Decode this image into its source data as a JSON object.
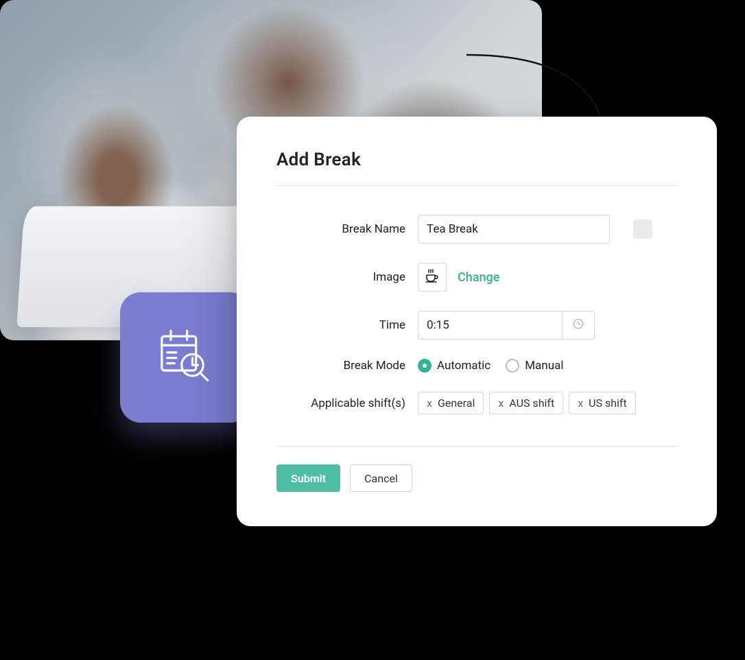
{
  "dialog": {
    "title": "Add Break",
    "fields": {
      "break_name": {
        "label": "Break Name",
        "value": "Tea Break"
      },
      "image": {
        "label": "Image",
        "change_label": "Change",
        "icon": "tea-cup"
      },
      "time": {
        "label": "Time",
        "value": "0:15"
      },
      "break_mode": {
        "label": "Break Mode",
        "options": [
          {
            "label": "Automatic",
            "selected": true
          },
          {
            "label": "Manual",
            "selected": false
          }
        ]
      },
      "applicable_shifts": {
        "label": "Applicable shift(s)",
        "items": [
          "General",
          "AUS shift",
          "US shift"
        ]
      }
    },
    "actions": {
      "submit": "Submit",
      "cancel": "Cancel"
    }
  },
  "tile": {
    "icon": "calendar-magnify"
  }
}
